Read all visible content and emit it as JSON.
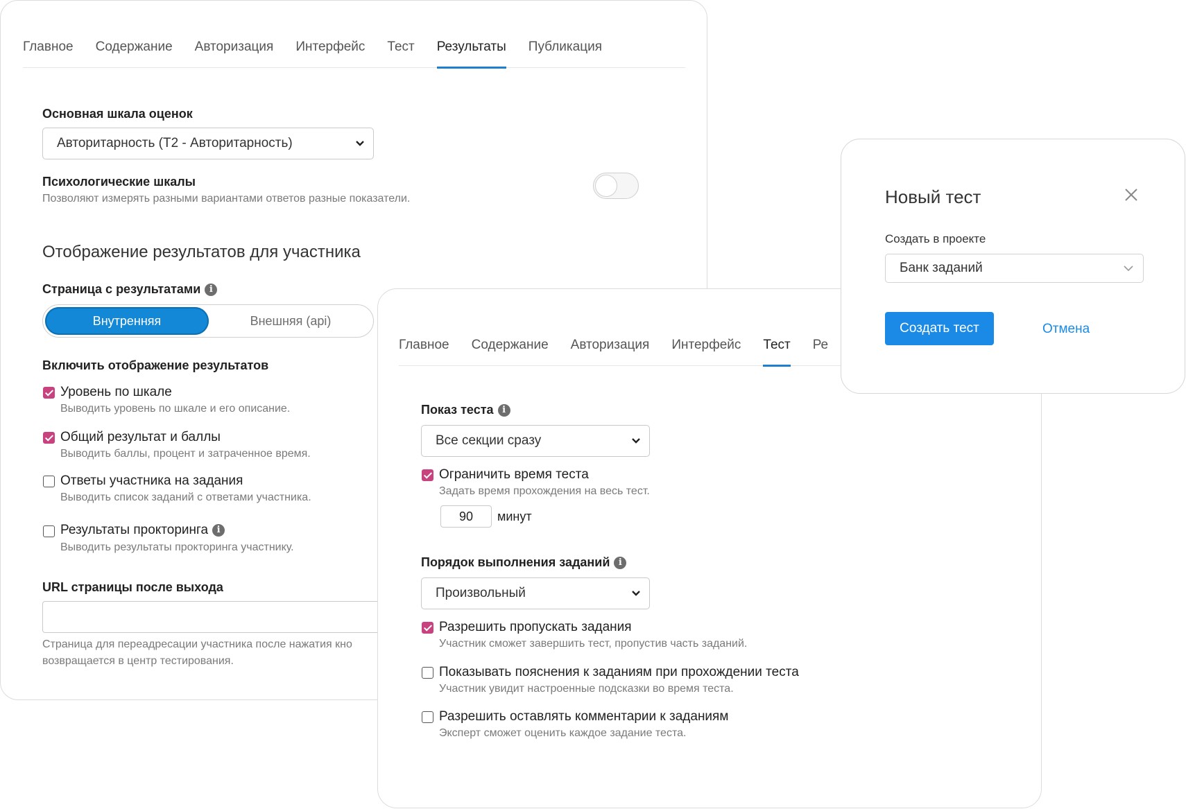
{
  "back_card": {
    "tabs": [
      "Главное",
      "Содержание",
      "Авторизация",
      "Интерфейс",
      "Тест",
      "Результаты",
      "Публикация"
    ],
    "active_tab": 5,
    "main_scale_label": "Основная шкала оценок",
    "main_scale_value": "Авторитарность (Т2 - Авторитарность)",
    "psych_scales_label": "Психологические шкалы",
    "psych_scales_hint": "Позволяют измерять разными вариантами ответов разные показатели.",
    "section_title": "Отображение результатов для участника",
    "results_page_label": "Страница с результатами",
    "segment_internal": "Внутренняя",
    "segment_external": "Внешняя (api)",
    "enable_display_label": "Включить отображение результатов",
    "options": [
      {
        "label": "Уровень по шкале",
        "hint": "Выводить уровень по шкале и его описание.",
        "checked": true
      },
      {
        "label": "Общий результат и баллы",
        "hint": "Выводить баллы, процент и затраченное время.",
        "checked": true
      },
      {
        "label": "Ответы участника на задания",
        "hint": "Выводить список заданий с ответами участника.",
        "checked": false
      },
      {
        "label": "Результаты прокторинга",
        "hint": "Выводить результаты прокторинга участнику.",
        "checked": false
      }
    ],
    "url_label": "URL страницы после выхода",
    "url_hint_1": "Страница для переадресации участника после нажатия кно",
    "url_hint_2": "возвращается в центр тестирования."
  },
  "middle_card": {
    "tabs": [
      "Главное",
      "Содержание",
      "Авторизация",
      "Интерфейс",
      "Тест",
      "Ре"
    ],
    "active_tab": 4,
    "show_test_label": "Показ теста",
    "show_test_value": "Все секции сразу",
    "limit_time_label": "Ограничить время теста",
    "limit_time_hint": "Задать время прохождения на весь тест.",
    "minutes_value": "90",
    "minutes_unit": "минут",
    "order_label": "Порядок выполнения заданий",
    "order_value": "Произвольный",
    "options": [
      {
        "label": "Разрешить пропускать задания",
        "hint": "Участник сможет завершить тест, пропустив часть заданий.",
        "checked": true
      },
      {
        "label": "Показывать пояснения к заданиям при прохождении теста",
        "hint": "Участник увидит настроенные подсказки во время теста.",
        "checked": false
      },
      {
        "label": "Разрешить оставлять комментарии к заданиям",
        "hint": "Эксперт сможет оценить каждое задание теста.",
        "checked": false
      }
    ]
  },
  "dialog": {
    "title": "Новый тест",
    "project_label": "Создать в проекте",
    "project_value": "Банк заданий",
    "create_button": "Создать тест",
    "cancel_button": "Отмена"
  },
  "colors": {
    "accent": "#1a8ae6",
    "checkbox": "#c7427e",
    "tab_underline": "#1e7fcf"
  }
}
